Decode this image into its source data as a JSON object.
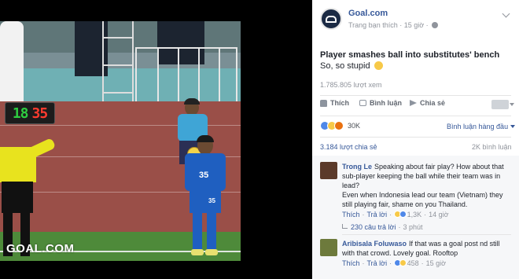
{
  "video": {
    "watermark": "GOAL.COM",
    "board_in": "18",
    "board_out": "35",
    "player_number": "35",
    "player_shorts_number": "35"
  },
  "post": {
    "page_name": "Goal.com",
    "page_meta": "Trang bạn thích · 15 giờ ·",
    "title": "Player smashes ball into substitutes' bench",
    "subtitle": "So, so stupid",
    "views": "1.785.805 lượt xem"
  },
  "actions": {
    "like": "Thích",
    "comment": "Bình luận",
    "share": "Chia sẻ"
  },
  "stats": {
    "reactions": "30K",
    "sort_label": "Bình luận hàng đầu",
    "shares": "3.184 lượt chia sẻ",
    "comments": "2K bình luận"
  },
  "comments": [
    {
      "name": "Trong Le",
      "text": "Speaking about fair play? How about that sub-player keeping the ball while their team was in lead?",
      "text2": "Even when Indonesia lead our team (Vietnam) they still playing fair, shame on you Thailand.",
      "like": "Thích",
      "reply": "Trả lời",
      "reaction_count": "1,3K",
      "time": "14 giờ",
      "replies": "230 câu trả lời",
      "replies_time": "3 phút"
    },
    {
      "name": "Aribisala Foluwaso",
      "text": "If that was a goal post nd still with that crowd. Lovely goal. Rooftop",
      "like": "Thích",
      "reply": "Trả lời",
      "reaction_count": "458",
      "time": "15 giờ"
    }
  ],
  "colors": {
    "link": "#365899",
    "muted": "#90949c",
    "like_reaction": "#4f88e8",
    "haha_reaction": "#f7c948",
    "angry_reaction": "#e9710f",
    "board_in": "#2ecc40",
    "board_out": "#ff3b2f"
  }
}
